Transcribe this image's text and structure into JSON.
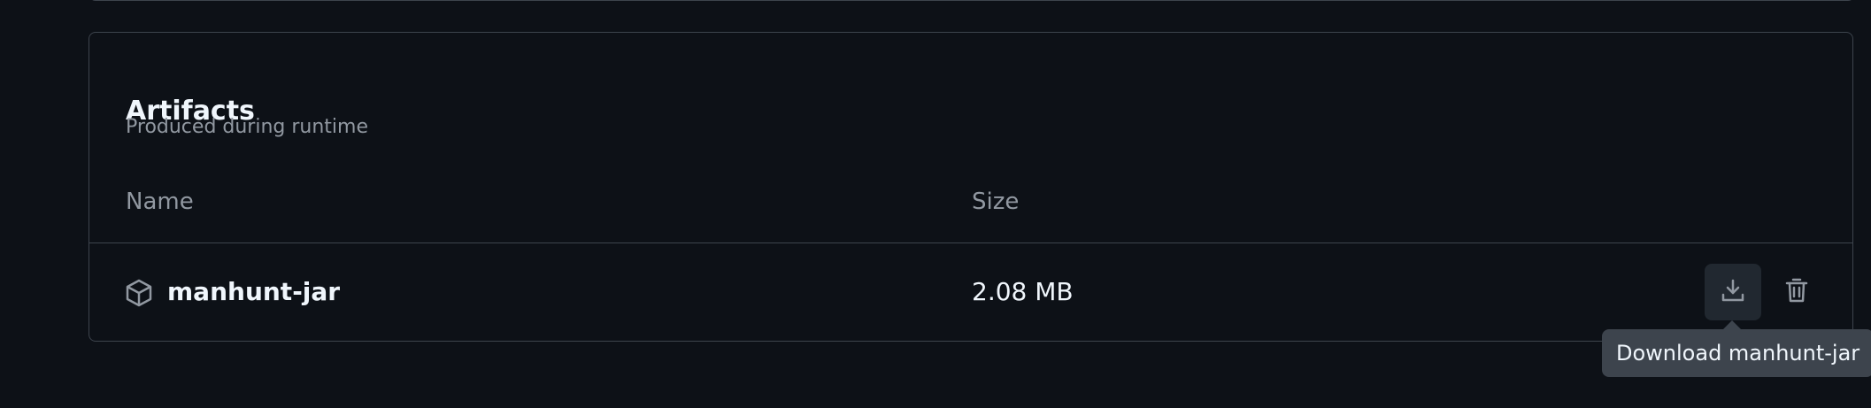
{
  "artifacts": {
    "title": "Artifacts",
    "subtitle": "Produced during runtime",
    "columns": {
      "name": "Name",
      "size": "Size"
    },
    "items": [
      {
        "name": "manhunt-jar",
        "size": "2.08 MB",
        "icon": "package-icon"
      }
    ]
  },
  "tooltip": {
    "text": "Download manhunt-jar"
  },
  "colors": {
    "background": "#0d1117",
    "border": "#3d444d",
    "text_primary": "#f0f6fc",
    "text_muted": "#9198a1",
    "button_bg": "#212830",
    "tooltip_bg": "#3d444d"
  }
}
